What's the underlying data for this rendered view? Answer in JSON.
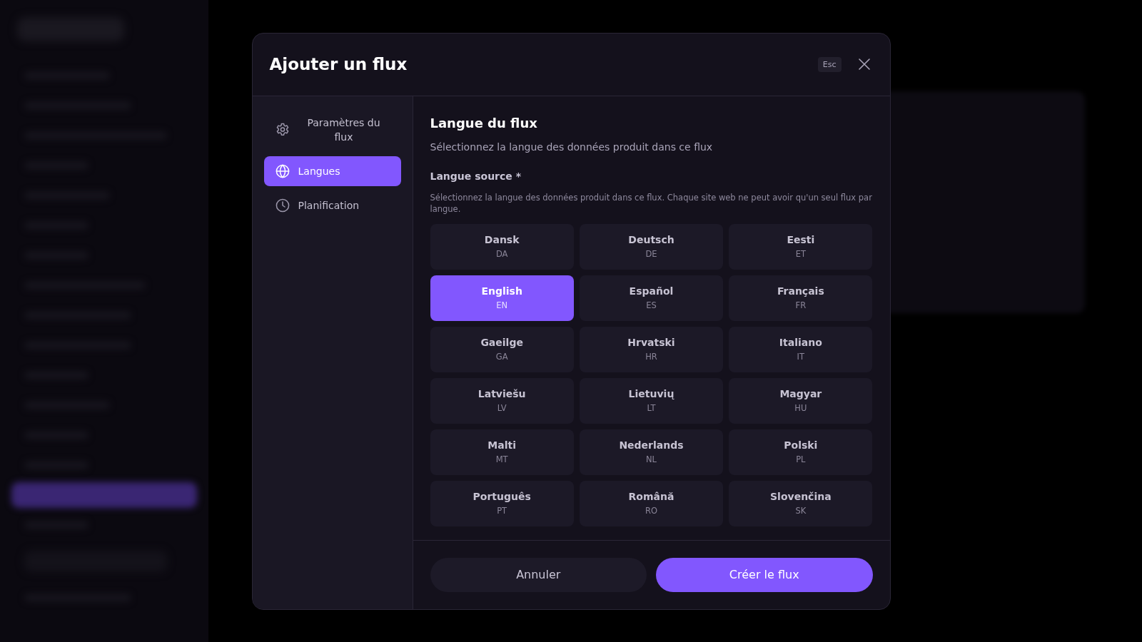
{
  "dialog": {
    "title": "Ajouter un flux",
    "shortcut": "Esc"
  },
  "nav": [
    {
      "label": "Paramètres du flux",
      "selected": false
    },
    {
      "label": "Langues",
      "selected": true
    },
    {
      "label": "Planification",
      "selected": false
    }
  ],
  "section": {
    "title": "Langue du flux",
    "subtitle": "Sélectionnez la langue des données produit dans ce flux",
    "field_label": "Langue source *",
    "help": "Sélectionnez la langue des données produit dans ce flux. Chaque site web ne peut avoir qu'un seul flux par langue."
  },
  "languages": [
    {
      "name": "Dansk",
      "code": "DA",
      "selected": false
    },
    {
      "name": "Deutsch",
      "code": "DE",
      "selected": false
    },
    {
      "name": "Eesti",
      "code": "ET",
      "selected": false
    },
    {
      "name": "English",
      "code": "EN",
      "selected": true
    },
    {
      "name": "Español",
      "code": "ES",
      "selected": false
    },
    {
      "name": "Français",
      "code": "FR",
      "selected": false
    },
    {
      "name": "Gaeilge",
      "code": "GA",
      "selected": false
    },
    {
      "name": "Hrvatski",
      "code": "HR",
      "selected": false
    },
    {
      "name": "Italiano",
      "code": "IT",
      "selected": false
    },
    {
      "name": "Latviešu",
      "code": "LV",
      "selected": false
    },
    {
      "name": "Lietuvių",
      "code": "LT",
      "selected": false
    },
    {
      "name": "Magyar",
      "code": "HU",
      "selected": false
    },
    {
      "name": "Malti",
      "code": "MT",
      "selected": false
    },
    {
      "name": "Nederlands",
      "code": "NL",
      "selected": false
    },
    {
      "name": "Polski",
      "code": "PL",
      "selected": false
    },
    {
      "name": "Português",
      "code": "PT",
      "selected": false
    },
    {
      "name": "Română",
      "code": "RO",
      "selected": false
    },
    {
      "name": "Slovenčina",
      "code": "SK",
      "selected": false
    }
  ],
  "footer": {
    "buttons": [
      {
        "label": "Annuler",
        "kind": "secondary"
      },
      {
        "label": "Créer le flux",
        "kind": "primary"
      }
    ]
  }
}
